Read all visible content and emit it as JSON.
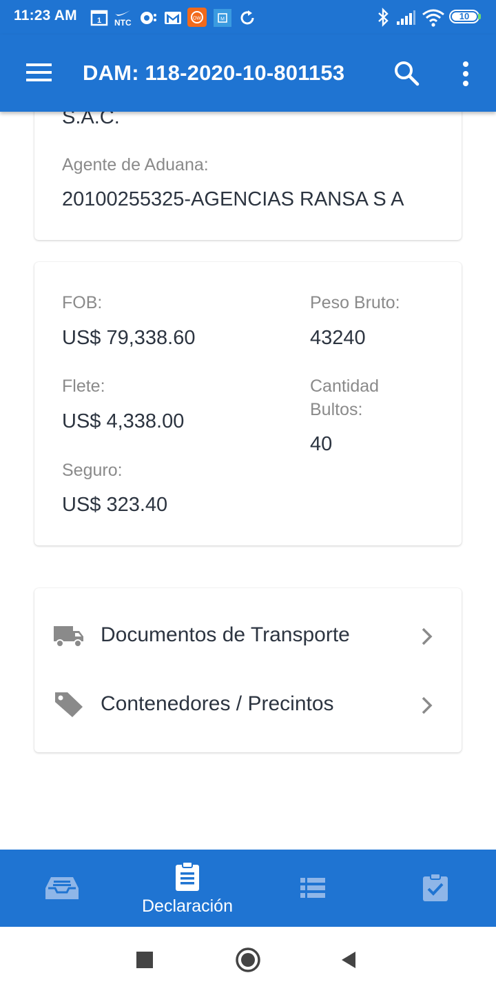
{
  "status_bar": {
    "time": "11:23 AM",
    "battery": "10",
    "ntc_label": "NTC",
    "icons": [
      "calendar-1-icon",
      "nike-ntc-icon",
      "location-pin-icon",
      "gmail-icon",
      "app-orange-icon",
      "app-blue-icon",
      "sync-icon",
      "bluetooth-icon",
      "signal-icon",
      "wifi-icon",
      "battery-icon"
    ]
  },
  "app_bar": {
    "title": "DAM: 118-2020-10-801153"
  },
  "top_card": {
    "partial_text": "S.A.C.",
    "agente_label": "Agente de Aduana:",
    "agente_value": "20100255325-AGENCIAS RANSA S A"
  },
  "values_card": {
    "fob_label": "FOB:",
    "fob_value": "US$ 79,338.60",
    "flete_label": "Flete:",
    "flete_value": "US$ 4,338.00",
    "seguro_label": "Seguro:",
    "seguro_value": "US$ 323.40",
    "peso_label": "Peso Bruto:",
    "peso_value": "43240",
    "cantidad_label_line1": "Cantidad",
    "cantidad_label_line2": "Bultos:",
    "cantidad_value": "40"
  },
  "links_card": {
    "items": [
      {
        "label": "Documentos de Transporte",
        "icon": "truck-icon"
      },
      {
        "label": "Contenedores / Precintos",
        "icon": "tag-icon"
      }
    ]
  },
  "bottom_nav": {
    "items": [
      {
        "icon": "inbox-icon",
        "label": ""
      },
      {
        "icon": "clipboard-icon",
        "label": "Declaración",
        "active": true
      },
      {
        "icon": "list-icon",
        "label": ""
      },
      {
        "icon": "clipboard-check-icon",
        "label": ""
      }
    ]
  },
  "colors": {
    "primary": "#1f74d2",
    "text_dark": "#2c3440",
    "text_label": "#8a8a8a",
    "nav_inactive": "#8fb6e8"
  }
}
